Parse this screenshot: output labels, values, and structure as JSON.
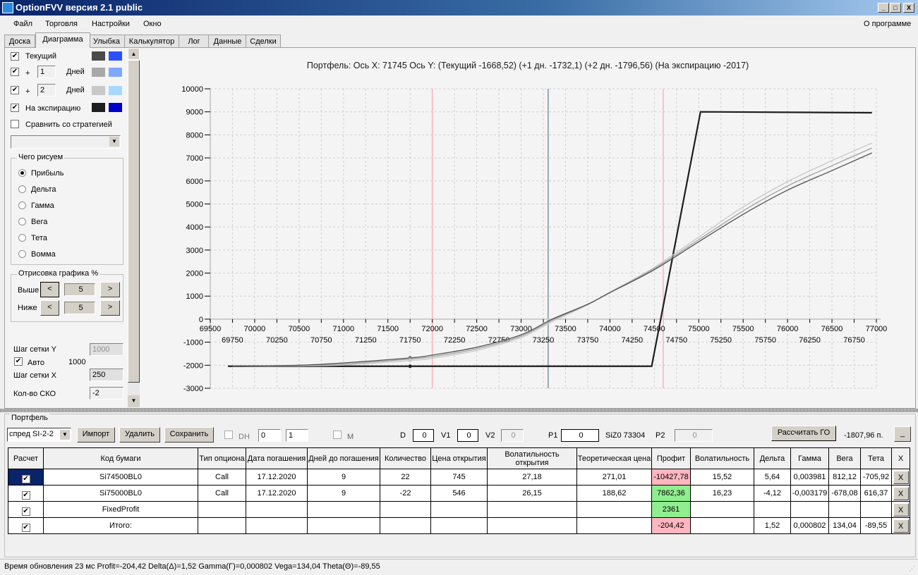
{
  "window": {
    "title": "OptionFVV версия 2.1 public",
    "controls": [
      "_",
      "□",
      "X"
    ]
  },
  "menu": {
    "items": [
      "Файл",
      "Торговля",
      "Настройки",
      "Окно"
    ],
    "about": "О программе"
  },
  "tabs": [
    "Доска",
    "Диаграмма",
    "Улыбка",
    "Калькулятор",
    "Лог",
    "Данные",
    "Сделки"
  ],
  "active_tab": "Диаграмма",
  "left": {
    "current": {
      "label": "Текущий",
      "checked": true,
      "colors": [
        "#4a4a4a",
        "#2a50ff"
      ]
    },
    "plus1": {
      "prefix": "+",
      "value": "1",
      "suffix": "Дней",
      "checked": true,
      "colors": [
        "#a8a8a8",
        "#80a8ff"
      ]
    },
    "plus2": {
      "prefix": "+",
      "value": "2",
      "suffix": "Дней",
      "checked": true,
      "colors": [
        "#c8c8c8",
        "#a8d8ff"
      ]
    },
    "expiry": {
      "label": "На экспирацию",
      "checked": true,
      "colors": [
        "#1e1e1e",
        "#0000c8"
      ]
    },
    "compare": {
      "label": "Сравнить со стратегией",
      "checked": false
    },
    "draw_group": {
      "title": "Чего рисуем",
      "options": [
        "Прибыль",
        "Дельта",
        "Гамма",
        "Вега",
        "Тета",
        "Вомма"
      ],
      "selected": "Прибыль"
    },
    "range_group": {
      "title": "Отрисовка графика %",
      "above_label": "Выше",
      "above": "5",
      "below_label": "Ниже",
      "below": "5",
      "prev": "<",
      "next": ">"
    },
    "grid_y_label": "Шаг сетки Y",
    "grid_y": "1000",
    "auto_label": "Авто",
    "auto_checked": true,
    "auto_value": "1000",
    "grid_x_label": "Шаг сетки X",
    "grid_x": "250",
    "sko_label": "Кол-во СКО",
    "sko": "-2"
  },
  "chart_data": {
    "type": "line",
    "title": "Портфель: Ось X: 71745 Ось Y:  (Текущий -1668,52)  (+1 дн. -1732,1)  (+2 дн. -1796,56)  (На экспирацию -2017)",
    "xlim": [
      69500,
      77000
    ],
    "ylim": [
      -3000,
      10000
    ],
    "grid": true,
    "xticks_major": [
      69500,
      70000,
      70500,
      71000,
      71500,
      72000,
      72500,
      73000,
      73500,
      74000,
      74500,
      75000,
      75500,
      76000,
      76500,
      77000
    ],
    "xticks_minor": [
      69750,
      70250,
      70750,
      71250,
      71750,
      72250,
      72750,
      73250,
      73750,
      74250,
      74750,
      75250,
      75750,
      76250,
      76750
    ],
    "yticks": [
      10000,
      9000,
      8000,
      7000,
      6000,
      5000,
      4000,
      3000,
      2000,
      1000,
      0,
      -1000,
      -2000,
      -3000
    ],
    "vlines": [
      {
        "x": 72000,
        "color": "#ffb0c0"
      },
      {
        "x": 73304,
        "color": "#8090a8"
      },
      {
        "x": 74600,
        "color": "#ffb0c0"
      }
    ],
    "cursor_x": 71750,
    "series": [
      {
        "key": "current",
        "color": "#505050",
        "x": [
          69750,
          70500,
          71000,
          71750,
          72000,
          72500,
          73000,
          73350,
          73750,
          74000,
          74500,
          75000,
          75500,
          76000,
          76500,
          76950
        ],
        "y": [
          -2045,
          -2000,
          -1900,
          -1685,
          -1560,
          -1220,
          -680,
          0,
          650,
          1150,
          2150,
          3360,
          4550,
          5600,
          6450,
          7216
        ]
      },
      {
        "key": "plus1",
        "color": "#a0a0a0",
        "x": [
          69750,
          70500,
          71000,
          71750,
          72000,
          72500,
          73000,
          73350,
          73750,
          74000,
          74500,
          75000,
          75500,
          76000,
          76500,
          76950
        ],
        "y": [
          -2045,
          -2020,
          -1950,
          -1732,
          -1630,
          -1290,
          -740,
          -50,
          640,
          1160,
          2200,
          3450,
          4700,
          5780,
          6660,
          7430
        ]
      },
      {
        "key": "plus2",
        "color": "#c8c8c8",
        "x": [
          69750,
          70500,
          71000,
          71750,
          72000,
          72500,
          73000,
          73350,
          73750,
          74000,
          74500,
          75000,
          75500,
          76000,
          76500,
          76950
        ],
        "y": [
          -2045,
          -2035,
          -1990,
          -1797,
          -1700,
          -1360,
          -800,
          -110,
          620,
          1170,
          2250,
          3560,
          4870,
          5970,
          6880,
          7645
        ]
      },
      {
        "key": "expiry",
        "color": "#1e1e1e",
        "x": [
          69700,
          74470,
          75020,
          76950
        ],
        "y": [
          -2045,
          -2045,
          9000,
          8960
        ]
      }
    ]
  },
  "portfolio": {
    "title": "Портфель",
    "strategy": "спред SI-2-2",
    "import": "Импорт",
    "delete": "Удалить",
    "save": "Сохранить",
    "dh_label": "DH",
    "dh_checked": false,
    "spin1": "0",
    "spin2": "1",
    "m_label": "M",
    "m_checked": false,
    "d_label": "D",
    "d": "0",
    "v1_label": "V1",
    "v1": "0",
    "v2_label": "V2",
    "v2": "0",
    "p1_label": "P1",
    "p1": "0",
    "futures": "SiZ0 73304",
    "p2_label": "P2",
    "p2": "0",
    "calc_go": "Рассчитать ГО",
    "go_value": "-1807,96 п.",
    "minimize": "_",
    "columns": [
      "Расчет",
      "Код бумаги",
      "Тип опциона",
      "Дата погашения",
      "Дней до погашения",
      "Количество",
      "Цена открытия",
      "Волатильность открытия",
      "Теоретическая цена",
      "Профит",
      "Волатильность",
      "Дельта",
      "Гамма",
      "Вега",
      "Тета",
      "X"
    ],
    "rows": [
      {
        "calc": true,
        "code": "Si74500BL0",
        "type": "Call",
        "date": "17.12.2020",
        "days": "9",
        "qty": "22",
        "price": "745",
        "vol_open": "27,18",
        "theor": "271,01",
        "profit": "-10427,78",
        "profit_color": "#ffb6c1",
        "vol": "15,52",
        "delta": "5,64",
        "gamma": "0,003981",
        "vega": "812,12",
        "theta": "-705,92",
        "del": "X"
      },
      {
        "calc": true,
        "code": "Si75000BL0",
        "type": "Call",
        "date": "17.12.2020",
        "days": "9",
        "qty": "-22",
        "price": "546",
        "vol_open": "26,15",
        "theor": "188,62",
        "profit": "7862,36",
        "profit_color": "#90ee90",
        "vol": "16,23",
        "delta": "-4,12",
        "gamma": "-0,003179",
        "vega": "-678,08",
        "theta": "616,37",
        "del": "X"
      },
      {
        "calc": true,
        "code": "FixedProfit",
        "type": "",
        "date": "",
        "days": "",
        "qty": "",
        "price": "",
        "vol_open": "",
        "theor": "",
        "profit": "2361",
        "profit_color": "#90ee90",
        "vol": "",
        "delta": "",
        "gamma": "",
        "vega": "",
        "theta": "",
        "del": "X"
      },
      {
        "calc": true,
        "code": "Итого:",
        "type": "",
        "date": "",
        "days": "",
        "qty": "",
        "price": "",
        "vol_open": "",
        "theor": "",
        "profit": "-204,42",
        "profit_color": "#ffb6c1",
        "vol": "",
        "delta": "1,52",
        "gamma": "0,000802",
        "vega": "134,04",
        "theta": "-89,55",
        "del": "X"
      }
    ]
  },
  "status": "Время обновления 23 мс   Profit=-204,42 Delta(Δ)=1,52 Gamma(Γ)=0,000802 Vega=134,04 Theta(Θ)=-89,55"
}
